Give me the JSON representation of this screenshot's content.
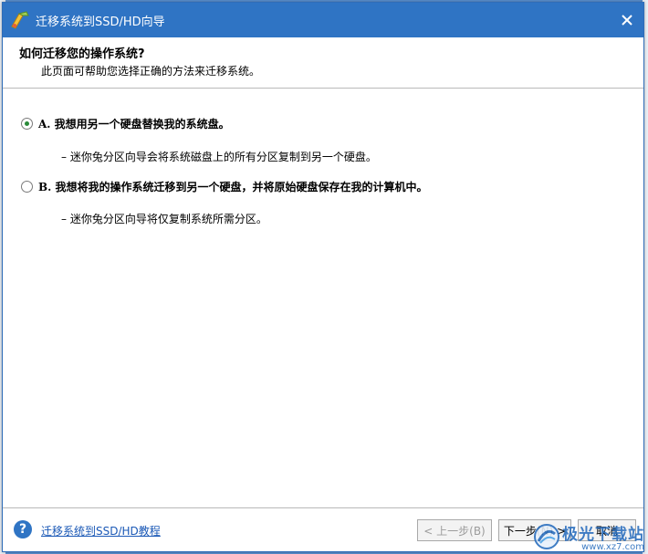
{
  "window": {
    "title": "迁移系统到SSD/HD向导",
    "close_icon": "close-icon",
    "app_icon": "wizard-icon"
  },
  "header": {
    "title": "如何迁移您的操作系统?",
    "subtitle": "此页面可帮助您选择正确的方法来迁移系统。"
  },
  "options": [
    {
      "label": "A. 我想用另一个硬盘替换我的系统盘。",
      "description": "– 迷你兔分区向导会将系统磁盘上的所有分区复制到另一个硬盘。",
      "selected": true
    },
    {
      "label": "B. 我想将我的操作系统迁移到另一个硬盘，并将原始硬盘保存在我的计算机中。",
      "description": "– 迷你兔分区向导将仅复制系统所需分区。",
      "selected": false
    }
  ],
  "footer": {
    "help_icon": "help-icon",
    "help_link": "迁移系统到SSD/HD教程",
    "back_label": "< 上一步(B)",
    "next_label": "下一步(N) >",
    "cancel_label": "取消"
  },
  "watermark": {
    "text": "极光下载站",
    "url": "www.xz7.com"
  },
  "colors": {
    "titlebar": "#2f74c4",
    "link": "#1a58b6",
    "radio_checked": "#2a8a3a"
  }
}
